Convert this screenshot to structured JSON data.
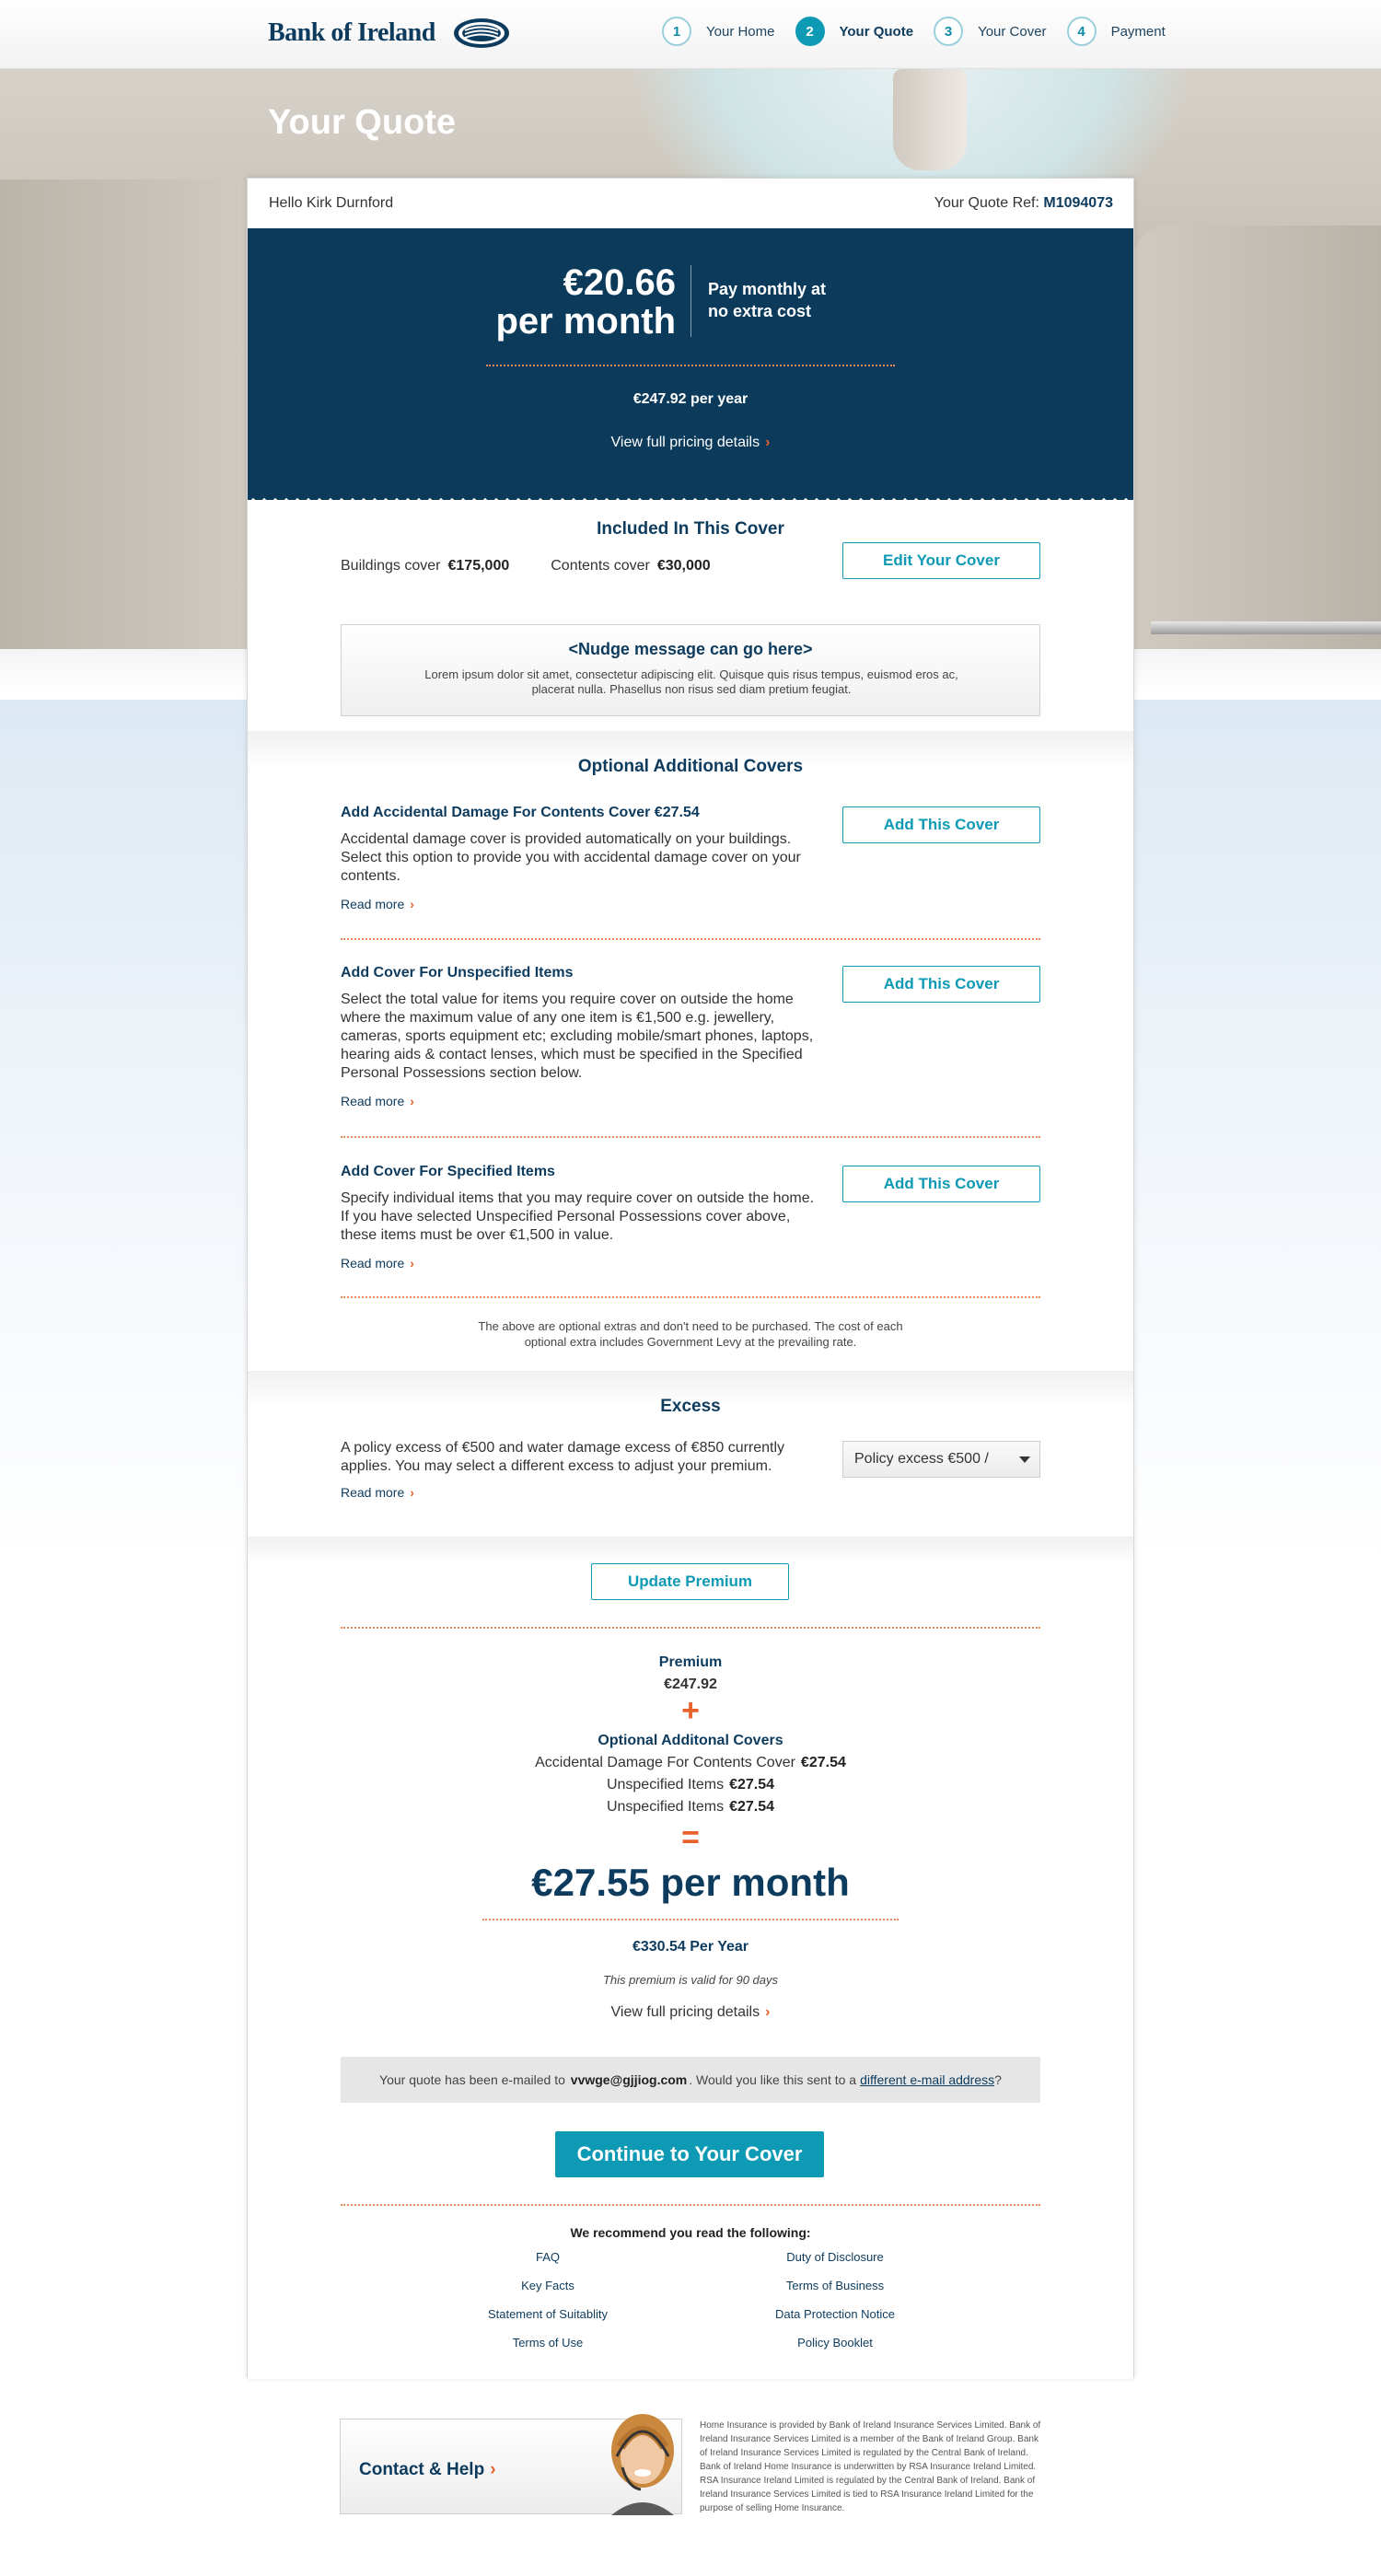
{
  "brand": {
    "name": "Bank of Ireland"
  },
  "steps": [
    {
      "num": "1",
      "label": "Your Home"
    },
    {
      "num": "2",
      "label": "Your Quote"
    },
    {
      "num": "3",
      "label": "Your Cover"
    },
    {
      "num": "4",
      "label": "Payment"
    }
  ],
  "page_title": "Your Quote",
  "greeting": "Hello Kirk Durnford",
  "quote_ref": {
    "label": "Your Quote Ref:",
    "value": "M1094073"
  },
  "pricing": {
    "monthly_amount": "€20.66",
    "monthly_unit": "per month",
    "note_line1": "Pay monthly at",
    "note_line2": "no extra cost",
    "yearly": "€247.92 per year",
    "details_link": "View full pricing details"
  },
  "included": {
    "title": "Included In This Cover",
    "buildings_label": "Buildings cover",
    "buildings_value": "€175,000",
    "contents_label": "Contents cover",
    "contents_value": "€30,000",
    "edit_button": "Edit Your Cover"
  },
  "nudge": {
    "title": "<Nudge message can go here>",
    "body": "Lorem ipsum dolor sit amet, consectetur adipiscing elit. Quisque quis risus tempus, euismod eros ac, placerat nulla. Phasellus non risus sed diam pretium feugiat."
  },
  "optional": {
    "title": "Optional Additional Covers",
    "items": [
      {
        "title": "Add Accidental Damage For Contents Cover €27.54",
        "desc": "Accidental damage cover is provided automatically on your buildings. Select this option to provide you with accidental damage cover on your contents.",
        "read_more": "Read more",
        "button": "Add This Cover"
      },
      {
        "title": "Add Cover For Unspecified Items",
        "desc": "Select the total value for items you require cover on outside the home where the maximum value of any one item is €1,500 e.g. jewellery, cameras, sports equipment etc; excluding mobile/smart phones, laptops, hearing aids & contact lenses, which must be specified in the Specified Personal Possessions section below.",
        "read_more": "Read more",
        "button": "Add This Cover"
      },
      {
        "title": "Add Cover For Specified Items",
        "desc": "Specify individual items that you may require cover on outside the home. If you have selected Unspecified Personal Possessions cover above, these items must be over €1,500 in value.",
        "read_more": "Read more",
        "button": "Add This Cover"
      }
    ],
    "note": "The above are optional extras and don't need to be purchased. The cost of each optional extra includes Government Levy at the prevailing rate."
  },
  "excess": {
    "title": "Excess",
    "desc": "A policy excess of €500 and water damage excess of €850 currently applies. You may select a different excess to adjust your premium.",
    "read_more": "Read more",
    "select_value": "Policy excess €500 /"
  },
  "summary": {
    "update_button": "Update Premium",
    "premium_label": "Premium",
    "premium_value": "€247.92",
    "plus": "+",
    "optional_label": "Optional Additonal Covers",
    "addons": [
      {
        "label": "Accidental Damage For Contents Cover",
        "value": "€27.54"
      },
      {
        "label": "Unspecified Items",
        "value": "€27.54"
      },
      {
        "label": "Unspecified Items",
        "value": "€27.54"
      }
    ],
    "equals": "=",
    "monthly_total": "€27.55 per month",
    "yearly_total": "€330.54 Per Year",
    "valid_note": "This premium is valid for 90 days",
    "details_link": "View full pricing details"
  },
  "email": {
    "prefix": "Your quote has been e-mailed to",
    "address": "vvwge@gjjiog.com",
    "middle": ". Would you like this sent to a",
    "link": "different e-mail address",
    "suffix": "?"
  },
  "continue_button": "Continue to Your Cover",
  "recommend": {
    "title": "We recommend you read the following:",
    "left": [
      "FAQ",
      "Key Facts",
      "Statement of Suitablity",
      "Terms of Use"
    ],
    "right": [
      "Duty of Disclosure",
      "Terms of Business",
      "Data Protection Notice",
      "Policy Booklet"
    ]
  },
  "contact": {
    "label": "Contact & Help"
  },
  "legal": "Home Insurance is provided by Bank of Ireland Insurance Services Limited. Bank of Ireland Insurance Services Limited is a member of the Bank of Ireland Group. Bank of Ireland Insurance Services Limited is regulated by the Central Bank of Ireland. Bank of Ireland Home Insurance is underwritten by RSA Insurance Ireland Limited. RSA Insurance Ireland Limited is regulated by the Central Bank of Ireland. Bank of Ireland Insurance Services Limited is tied to RSA Insurance Ireland Limited for the purpose of selling Home Insurance.",
  "colors": {
    "navy": "#0b3a5b",
    "teal": "#0e9ab5",
    "accent_orange": "#e8622c"
  },
  "icons": [
    "boi-logo-icon",
    "chevron-right-icon",
    "dropdown-caret-icon",
    "headset-agent-icon"
  ]
}
